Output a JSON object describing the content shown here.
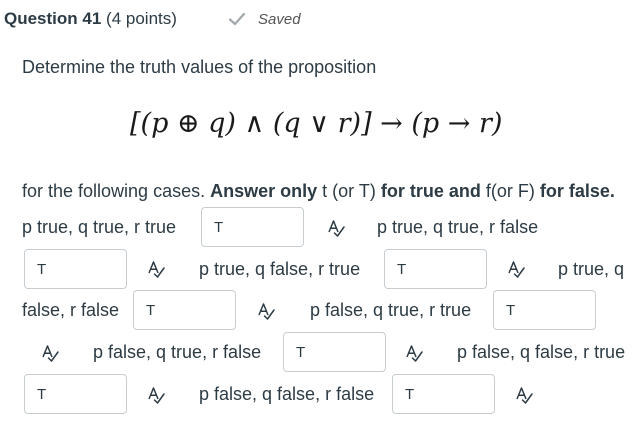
{
  "question": {
    "title": "Question 41",
    "points": "(4 points)",
    "status": "Saved"
  },
  "prompt": "Determine the truth values of the proposition",
  "formula": "[(p ⊕ q) ∧ (q ∨ r)] → (p → r)",
  "instructions": {
    "part1": "for the following cases.",
    "part2": "Answer only",
    "part3": "t (or T)",
    "part4": "for true and",
    "part5": "f(or F)",
    "part6": "for false."
  },
  "cases": [
    {
      "label": "p true, q true, r true",
      "answer": "T"
    },
    {
      "label": "p true, q true, r false",
      "answer": "T"
    },
    {
      "label": "p true, q false, r true",
      "answer": "T"
    },
    {
      "label_line1": "p true, q",
      "label_line2": "false, r false",
      "answer": "T"
    },
    {
      "label": "p false, q true, r true",
      "answer": "T"
    },
    {
      "label": "p false, q true, r false",
      "answer": "T"
    },
    {
      "label": "p false, q false, r true",
      "answer": "T"
    },
    {
      "label": "p false, q false, r false",
      "answer": "T"
    }
  ],
  "icons": {
    "saved": "check-icon",
    "spellcheck": "spellcheck-icon"
  },
  "colors": {
    "text": "#2d3b45",
    "saved_check": "#a0a8ad",
    "input_border": "#c7cdd1"
  }
}
